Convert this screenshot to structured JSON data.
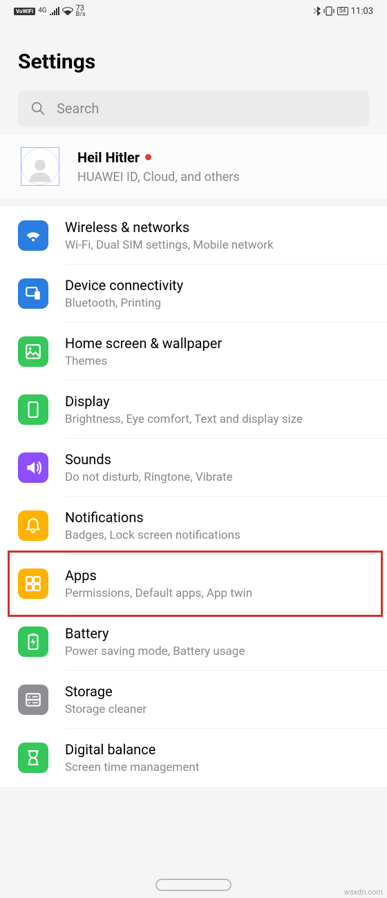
{
  "status_bar": {
    "vowifi": "VoWiFi",
    "signal_gen": "4G",
    "speed_num": "73",
    "speed_unit": "B/s",
    "battery": "54",
    "time": "11:03"
  },
  "header": {
    "title": "Settings"
  },
  "search": {
    "placeholder": "Search"
  },
  "account": {
    "name": "Heil Hitler",
    "subtitle": "HUAWEI ID, Cloud, and others"
  },
  "settings": [
    {
      "icon": "wifi-icon",
      "color": "c-blue",
      "title": "Wireless & networks",
      "sub": "Wi-Fi, Dual SIM settings, Mobile network"
    },
    {
      "icon": "device-connect-icon",
      "color": "c-blue",
      "title": "Device connectivity",
      "sub": "Bluetooth, Printing"
    },
    {
      "icon": "wallpaper-icon",
      "color": "c-green",
      "title": "Home screen & wallpaper",
      "sub": "Themes"
    },
    {
      "icon": "display-icon",
      "color": "c-green",
      "title": "Display",
      "sub": "Brightness, Eye comfort, Text and display size"
    },
    {
      "icon": "sound-icon",
      "color": "c-purple",
      "title": "Sounds",
      "sub": "Do not disturb, Ringtone, Vibrate"
    },
    {
      "icon": "bell-icon",
      "color": "c-yellow",
      "title": "Notifications",
      "sub": "Badges, Lock screen notifications"
    },
    {
      "icon": "apps-icon",
      "color": "c-yellow2",
      "title": "Apps",
      "sub": "Permissions, Default apps, App twin",
      "highlighted": true
    },
    {
      "icon": "battery-icon",
      "color": "c-green",
      "title": "Battery",
      "sub": "Power saving mode, Battery usage"
    },
    {
      "icon": "storage-icon",
      "color": "c-gray",
      "title": "Storage",
      "sub": "Storage cleaner"
    },
    {
      "icon": "balance-icon",
      "color": "c-green",
      "title": "Digital balance",
      "sub": "Screen time management"
    }
  ],
  "watermark": "wsxdn.com"
}
